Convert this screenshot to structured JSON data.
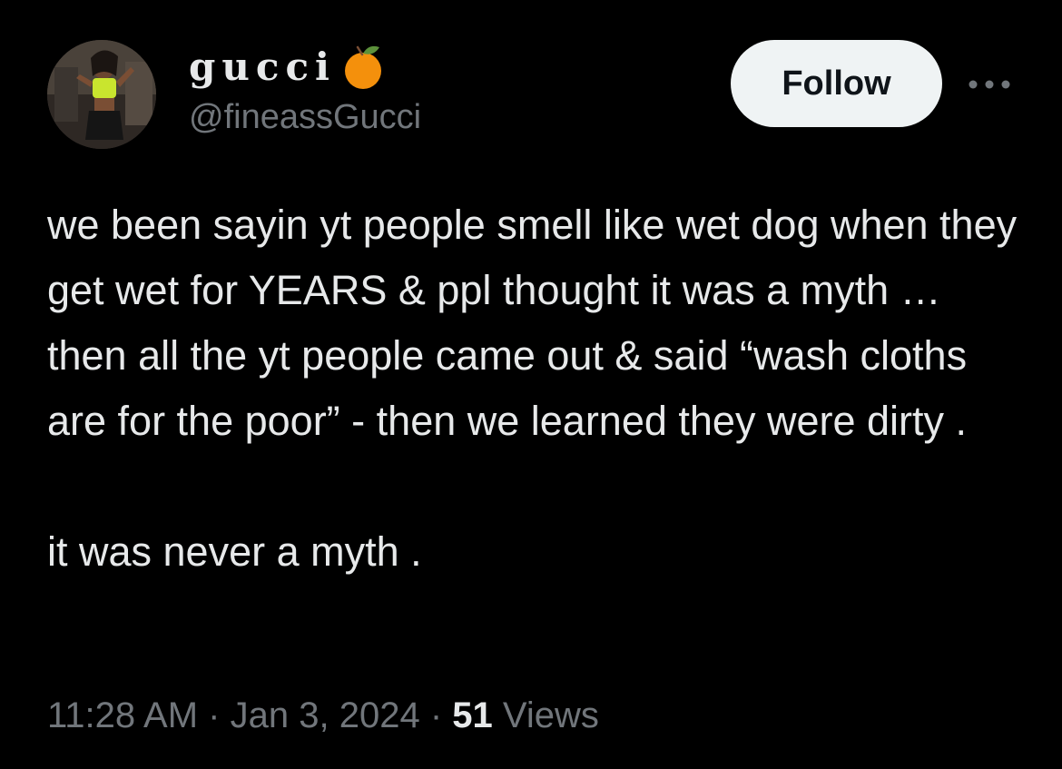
{
  "author": {
    "display_name": "gucci",
    "name_emoji": "tangerine-emoji",
    "handle": "@fineassGucci"
  },
  "actions": {
    "follow_label": "Follow",
    "more_icon": "ellipsis-icon"
  },
  "tweet": {
    "paragraphs": [
      "we been sayin yt people smell like wet dog when they get wet for YEARS & ppl thought it was a myth … then all the yt people came out & said “wash cloths are for the poor” - then we learned they were dirty .",
      "it was never a myth ."
    ]
  },
  "meta": {
    "time": "11:28 AM",
    "separator": "·",
    "date": "Jan 3, 2024",
    "views_count": "51",
    "views_label": "Views"
  },
  "colors": {
    "background": "#000000",
    "primary_text": "#e7e9ea",
    "secondary_text": "#71767b",
    "follow_bg": "#eff3f4",
    "follow_text": "#0f1419",
    "emoji_orange": "#f4900c",
    "emoji_leaf": "#5c913b"
  }
}
